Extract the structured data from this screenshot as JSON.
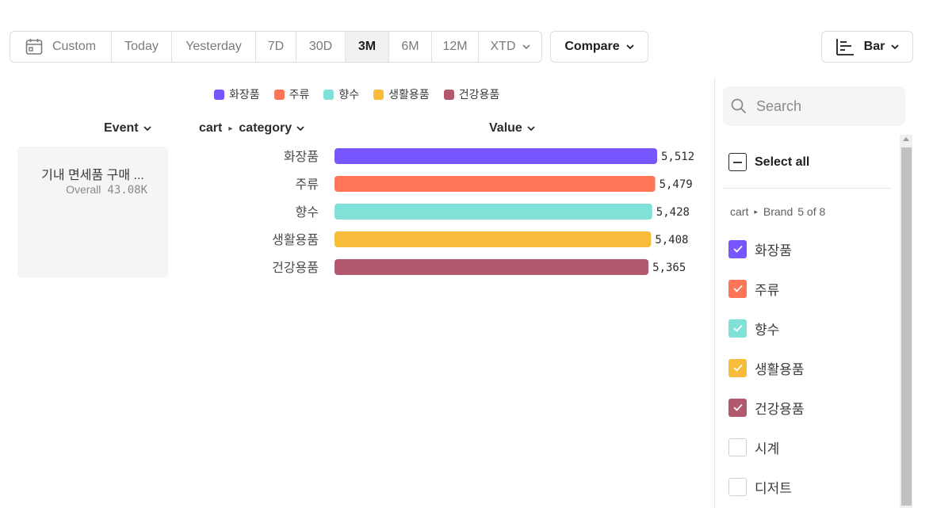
{
  "toolbar": {
    "ranges": [
      {
        "label": "Custom",
        "icon": "calendar-icon",
        "active": false
      },
      {
        "label": "Today",
        "active": false
      },
      {
        "label": "Yesterday",
        "active": false
      },
      {
        "label": "7D",
        "active": false
      },
      {
        "label": "30D",
        "active": false
      },
      {
        "label": "3M",
        "active": true
      },
      {
        "label": "6M",
        "active": false
      },
      {
        "label": "12M",
        "active": false
      },
      {
        "label": "XTD",
        "active": false,
        "icon": "chevron-down-icon"
      }
    ],
    "compare_label": "Compare",
    "viz_label": "Bar",
    "viz_icon": "bar-chart-icon"
  },
  "columns": {
    "event": "Event",
    "breakdown_prefix": "cart",
    "breakdown_property": "category",
    "value": "Value"
  },
  "event_card": {
    "name": "기내 면세품 구매 ...",
    "overall_label": "Overall",
    "overall_value": "43.08K"
  },
  "chart_data": {
    "type": "bar",
    "orientation": "horizontal",
    "categories": [
      "화장품",
      "주류",
      "향수",
      "생활용품",
      "건강용품"
    ],
    "values": [
      5512,
      5479,
      5428,
      5408,
      5365
    ],
    "value_labels": [
      "5,512",
      "5,479",
      "5,428",
      "5,408",
      "5,365"
    ],
    "colors": [
      "#7856ff",
      "#ff7557",
      "#80e1d9",
      "#f8bc3b",
      "#b2596e"
    ],
    "legend": [
      "화장품",
      "주류",
      "향수",
      "생활용품",
      "건강용품"
    ],
    "legend_position": "top",
    "xlim": [
      0,
      5512
    ],
    "grid": false
  },
  "filter_panel": {
    "search_placeholder": "Search",
    "select_all_label": "Select all",
    "group_prefix": "cart",
    "group_property": "Brand",
    "group_count": "5 of 8",
    "items": [
      {
        "label": "화장품",
        "checked": true,
        "color": "#7856ff"
      },
      {
        "label": "주류",
        "checked": true,
        "color": "#ff7557"
      },
      {
        "label": "향수",
        "checked": true,
        "color": "#80e1d9"
      },
      {
        "label": "생활용품",
        "checked": true,
        "color": "#f8bc3b"
      },
      {
        "label": "건강용품",
        "checked": true,
        "color": "#b2596e"
      },
      {
        "label": "시계",
        "checked": false,
        "color": ""
      },
      {
        "label": "디저트",
        "checked": false,
        "color": ""
      }
    ]
  }
}
